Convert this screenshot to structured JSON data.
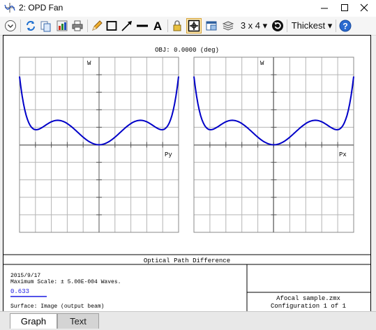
{
  "window": {
    "title": "2: OPD Fan"
  },
  "toolbar": {
    "layout_label": "3 x 4 ▾",
    "thickness_label": "Thickest ▾"
  },
  "plot": {
    "header": "OBJ: 0.0000 (deg)",
    "left_panel": {
      "ylabel": "W",
      "xlabel": "Py"
    },
    "right_panel": {
      "ylabel": "W",
      "xlabel": "Px"
    },
    "footer_title": "Optical Path Difference",
    "info": {
      "date": "2015/9/17",
      "scale": "Maximum Scale: ± 5.00E-004 Waves.",
      "wavelength": "0.633",
      "surface": "Surface: Image (output beam)"
    },
    "file": {
      "name": "Afocal sample.zmx",
      "config": "Configuration 1 of 1"
    },
    "series_color": "#0000c8"
  },
  "tabs": [
    {
      "label": "Graph"
    },
    {
      "label": "Text"
    }
  ]
}
